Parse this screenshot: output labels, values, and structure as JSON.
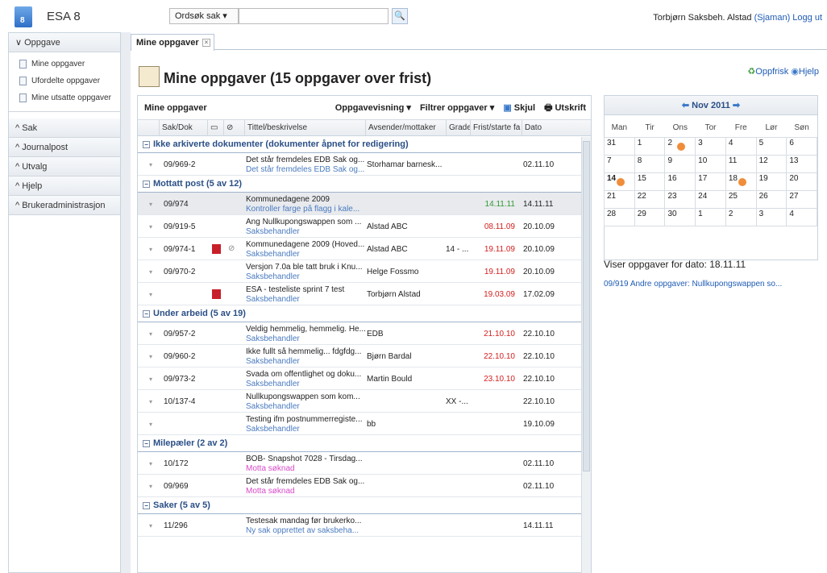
{
  "app": {
    "name": "ESA 8",
    "logo_text": "8"
  },
  "search": {
    "type_label": "Ordsøk sak ▾",
    "input_value": ""
  },
  "user": {
    "text": "Torbjørn Saksbeh. Alstad",
    "role": "(Sjaman)",
    "logout": "Logg ut"
  },
  "nav": {
    "groups": [
      {
        "label": "Oppgave",
        "expanded": true
      },
      {
        "label": "Sak"
      },
      {
        "label": "Journalpost"
      },
      {
        "label": "Utvalg"
      },
      {
        "label": "Hjelp"
      },
      {
        "label": "Brukeradministrasjon"
      }
    ],
    "items": [
      "Mine oppgaver",
      "Ufordelte oppgaver",
      "Mine utsatte oppgaver"
    ]
  },
  "tab": {
    "label": "Mine oppgaver"
  },
  "page": {
    "title": "Mine oppgaver (15 oppgaver over frist)",
    "refresh": "Oppfrisk",
    "help": "Hjelp"
  },
  "list": {
    "toolbar_title": "Mine oppgaver",
    "view": "Oppgavevisning ▾",
    "filter": "Filtrer oppgaver ▾",
    "hide": "Skjul",
    "print": "Utskrift",
    "columns": [
      "Sak/Dok",
      "Tittel/beskrivelse",
      "Avsender/mottaker",
      "Grade",
      "Frist/starte fa",
      "Dato"
    ],
    "groups": [
      {
        "label": "Ikke arkiverte dokumenter (dokumenter åpnet for redigering)",
        "rows": [
          {
            "sak": "09/969-2",
            "t1": "Det står fremdeles EDB Sak og...",
            "t2": "Det står fremdeles EDB Sak og...",
            "avs": "Storhamar barnesk...",
            "grad": "",
            "frist": "",
            "fc": "",
            "dato": "02.11.10"
          }
        ]
      },
      {
        "label": "Mottatt post (5 av 12)",
        "rows": [
          {
            "sak": "09/974",
            "t1": "Kommunedagene 2009",
            "t2": "Kontroller farge på flagg i kale...",
            "avs": "",
            "grad": "",
            "frist": "14.11.11",
            "fc": "green",
            "dato": "14.11.11",
            "sel": true
          },
          {
            "sak": "09/919-5",
            "t1": "Ang Nullkupongswappen som ...",
            "t2": "Saksbehandler",
            "avs": "Alstad ABC",
            "grad": "",
            "frist": "08.11.09",
            "fc": "red",
            "dato": "20.10.09"
          },
          {
            "sak": "09/974-1",
            "t1": "Kommunedagene 2009 (Hoved...",
            "t2": "Saksbehandler",
            "avs": "Alstad ABC",
            "grad": "14 - ...",
            "frist": "19.11.09",
            "fc": "red",
            "dato": "20.10.09",
            "pdf": true,
            "clip": true
          },
          {
            "sak": "09/970-2",
            "t1": "Versjon 7.0a ble tatt bruk i Knu...",
            "t2": "Saksbehandler",
            "avs": "Helge Fossmo",
            "grad": "",
            "frist": "19.11.09",
            "fc": "red",
            "dato": "20.10.09"
          },
          {
            "sak": "",
            "t1": "ESA - testeliste sprint 7 test",
            "t2": "Saksbehandler",
            "avs": "Torbjørn Alstad",
            "grad": "",
            "frist": "19.03.09",
            "fc": "red",
            "dato": "17.02.09",
            "pdf": true
          }
        ]
      },
      {
        "label": "Under arbeid (5 av 19)",
        "rows": [
          {
            "sak": "09/957-2",
            "t1": "Veldig hemmelig, hemmelig. He...",
            "t2": "Saksbehandler",
            "avs": "EDB",
            "grad": "",
            "frist": "21.10.10",
            "fc": "red",
            "dato": "22.10.10"
          },
          {
            "sak": "09/960-2",
            "t1": "Ikke fullt så hemmelig... fdgfdg...",
            "t2": "Saksbehandler",
            "avs": "Bjørn Bardal",
            "grad": "",
            "frist": "22.10.10",
            "fc": "red",
            "dato": "22.10.10"
          },
          {
            "sak": "09/973-2",
            "t1": "Svada om offentlighet og doku...",
            "t2": "Saksbehandler",
            "avs": "Martin Bould",
            "grad": "",
            "frist": "23.10.10",
            "fc": "red",
            "dato": "22.10.10"
          },
          {
            "sak": "10/137-4",
            "t1": "Nullkupongswappen som kom...",
            "t2": "Saksbehandler",
            "avs": "",
            "grad": "XX -...",
            "frist": "",
            "fc": "",
            "dato": "22.10.10"
          },
          {
            "sak": "",
            "t1": "Testing ifm postnummerregiste...",
            "t2": "Saksbehandler",
            "avs": "bb",
            "grad": "",
            "frist": "",
            "fc": "",
            "dato": "19.10.09"
          }
        ]
      },
      {
        "label": "Milepæler (2 av 2)",
        "rows": [
          {
            "sak": "10/172",
            "t1": "BOB- Snapshot 7028 - Tirsdag...",
            "t2": "Motta søknad",
            "pink": true,
            "avs": "",
            "grad": "",
            "frist": "",
            "fc": "",
            "dato": "02.11.10"
          },
          {
            "sak": "09/969",
            "t1": "Det står fremdeles EDB Sak og...",
            "t2": "Motta søknad",
            "pink": true,
            "avs": "",
            "grad": "",
            "frist": "",
            "fc": "",
            "dato": "02.11.10"
          }
        ]
      },
      {
        "label": "Saker (5 av 5)",
        "rows": [
          {
            "sak": "11/296",
            "t1": "Testesak mandag før brukerko...",
            "t2": "Ny sak opprettet av saksbeha...",
            "avs": "",
            "grad": "",
            "frist": "",
            "fc": "",
            "dato": "14.11.11"
          }
        ]
      }
    ]
  },
  "calendar": {
    "month": "Nov 2011",
    "days": [
      "Man",
      "Tir",
      "Ons",
      "Tor",
      "Fre",
      "Lør",
      "Søn"
    ],
    "weeks": [
      [
        "31",
        "1",
        "2",
        "3",
        "4",
        "5",
        "6"
      ],
      [
        "7",
        "8",
        "9",
        "10",
        "11",
        "12",
        "13"
      ],
      [
        "14",
        "15",
        "16",
        "17",
        "18",
        "19",
        "20"
      ],
      [
        "21",
        "22",
        "23",
        "24",
        "25",
        "26",
        "27"
      ],
      [
        "28",
        "29",
        "30",
        "1",
        "2",
        "3",
        "4"
      ]
    ]
  },
  "tasks": {
    "date_label": "Viser oppgaver for dato: 18.11.11",
    "item": "09/919 Andre oppgaver: Nullkupongswappen so..."
  }
}
